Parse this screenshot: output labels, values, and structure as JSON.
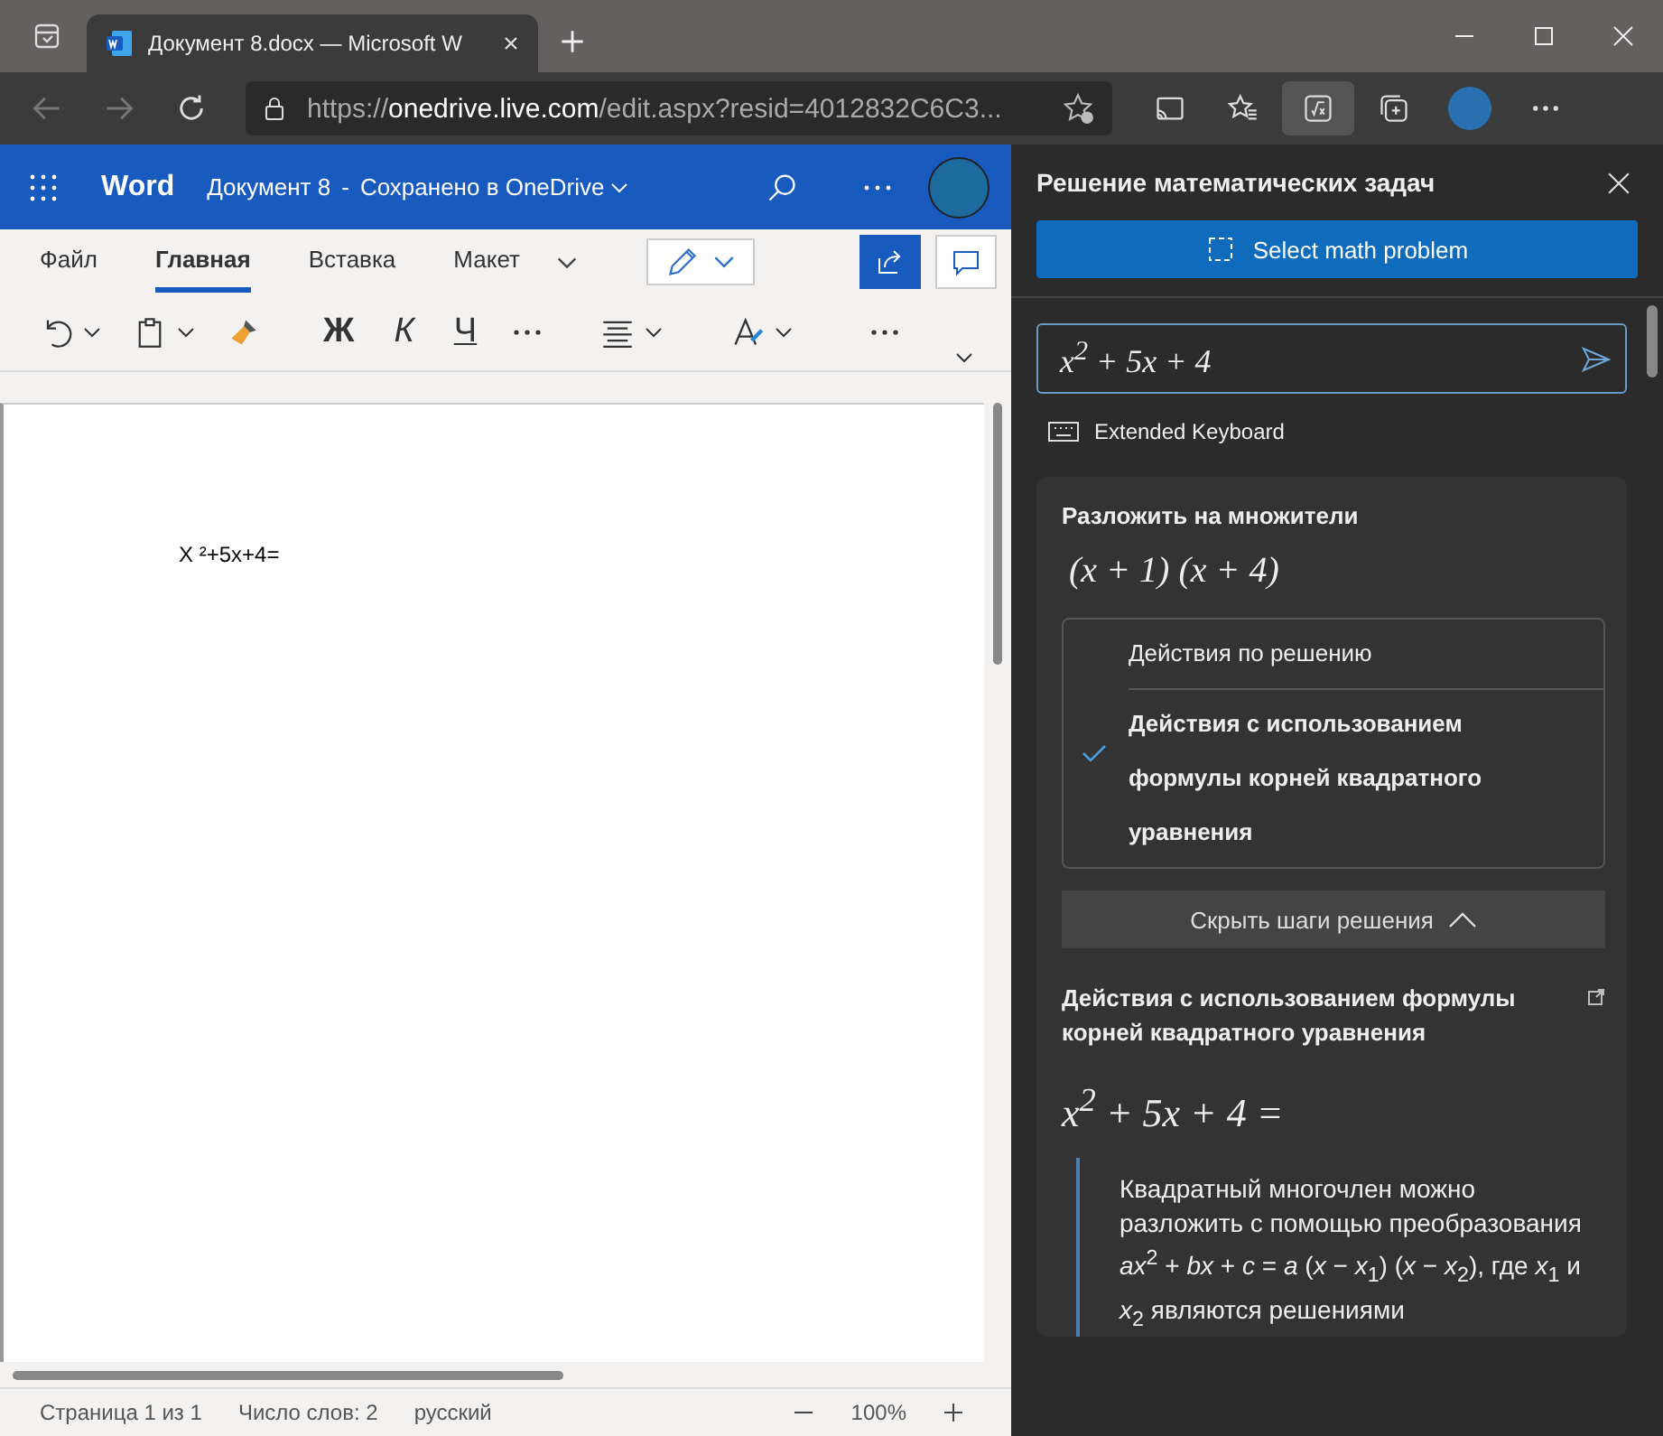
{
  "browser": {
    "tabs": [
      {
        "title": "Документ 8.docx — Microsoft W",
        "selected": true
      }
    ],
    "url": {
      "scheme": "https://",
      "host": "onedrive.live.com",
      "path": "/edit.aspx?resid=4012832C6C3..."
    }
  },
  "word": {
    "app_name": "Word",
    "doc_title": "Документ 8",
    "separator": "-",
    "save_status": "Сохранено в OneDrive",
    "ribbon_tabs": [
      {
        "label": "Файл",
        "selected": false
      },
      {
        "label": "Главная",
        "selected": true
      },
      {
        "label": "Вставка",
        "selected": false
      },
      {
        "label": "Макет",
        "selected": false
      }
    ],
    "format_buttons": [
      {
        "kind": "bold",
        "label": "Ж"
      },
      {
        "kind": "italic",
        "label": "К"
      },
      {
        "kind": "underline",
        "label": "Ч"
      }
    ],
    "document_text": "X ²+5x+4=",
    "status_bar": {
      "page": "Страница 1 из 1",
      "words": "Число слов: 2",
      "language": "русский",
      "zoom": "100%"
    }
  },
  "math_panel": {
    "title": "Решение математических задач",
    "select_button": "Select math problem",
    "input_value": "x$^{2}$ + 5x + 4",
    "extended_keyboard": "Extended Keyboard",
    "result": {
      "heading": "Разложить на множители",
      "answer": "(x + 1) (x + 4)",
      "methods": [
        {
          "label": "Действия по решению",
          "selected": false
        },
        {
          "label": "Действия с использованием формулы корней квадратного уравнения",
          "selected": true
        }
      ],
      "toggle_button": "Скрыть шаги решения"
    },
    "steps": {
      "heading": "Действия с использованием формулы корней квадратного уравнения",
      "expression": "x$^{2}$ + 5x + 4 =",
      "explanation": "Квадратный многочлен можно разложить с помощью преобразования *ax*$^{2}$ + *bx* + *c* = *a* (*x* − *x*$_{1}$) (*x* − *x*$_{2}$), где *x*$_{1}$ и *x*$_{2}$ являются решениями"
    }
  }
}
